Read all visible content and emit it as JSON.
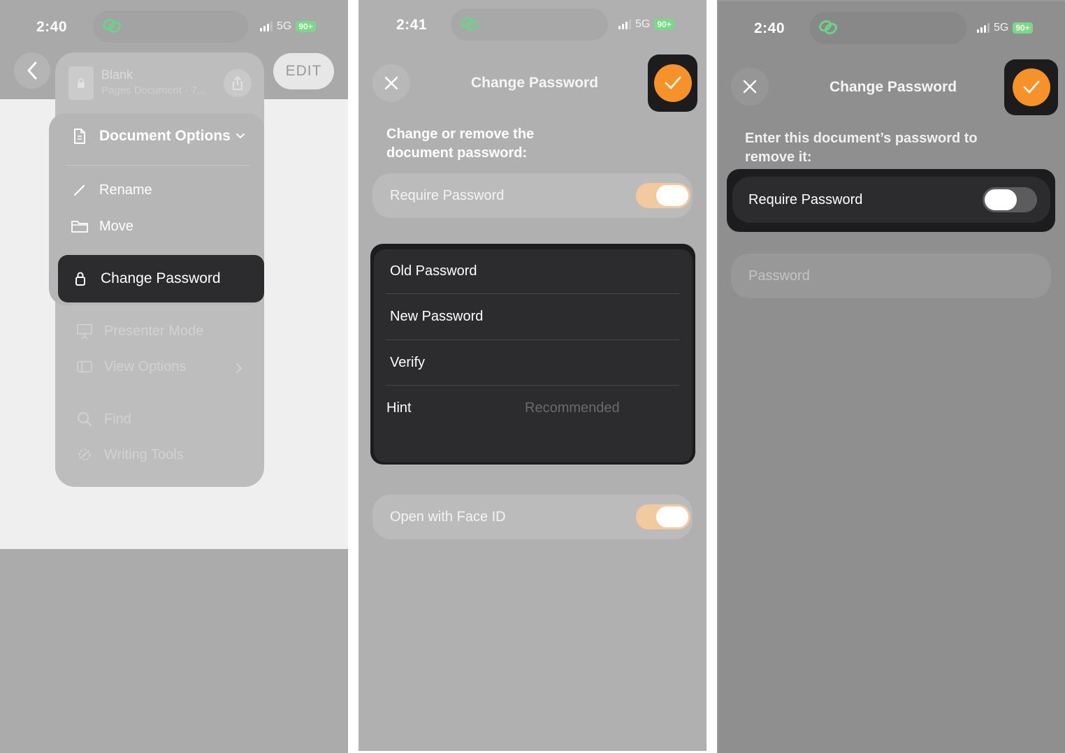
{
  "panel1": {
    "status": {
      "time": "2:40",
      "network": "5G",
      "battery": "90+"
    },
    "edit_label": "EDIT",
    "document": {
      "name": "Blank",
      "subtitle": "Pages Document · 7..."
    },
    "menu": {
      "header": "Document Options",
      "rename": "Rename",
      "move": "Move",
      "change_password": "Change Password",
      "presenter_mode": "Presenter Mode",
      "view_options": "View Options",
      "find": "Find",
      "writing_tools": "Writing Tools"
    }
  },
  "panel2": {
    "status": {
      "time": "2:41",
      "network": "5G",
      "battery": "90+"
    },
    "title": "Change Password",
    "subtitle": "Change or remove the document password:",
    "require_password": {
      "label": "Require Password",
      "on": true
    },
    "fields": {
      "old_password": "Old Password",
      "new_password": "New Password",
      "verify": "Verify",
      "hint_label": "Hint",
      "hint_placeholder": "Recommended"
    },
    "face_id": {
      "label": "Open with Face ID",
      "on": true
    }
  },
  "panel3": {
    "status": {
      "time": "2:40",
      "network": "5G",
      "battery": "90+"
    },
    "title": "Change Password",
    "subtitle": "Enter this document’s password to remove it:",
    "require_password": {
      "label": "Require Password",
      "on": false
    },
    "password_placeholder": "Password"
  },
  "colors": {
    "accent": "#f7922b",
    "toggle_on_dimmed": "#f3c9a0",
    "dark_card": "#2c2c2e",
    "wifi_green": "#7ed68b"
  },
  "icons": [
    "back-chevron-icon",
    "lock-icon",
    "share-icon",
    "document-icon",
    "chevron-down-icon",
    "pencil-icon",
    "folder-icon",
    "presenter-icon",
    "sidebar-icon",
    "chevron-right-icon",
    "search-icon",
    "writing-tools-icon",
    "close-icon",
    "checkmark-icon",
    "link-icon"
  ]
}
